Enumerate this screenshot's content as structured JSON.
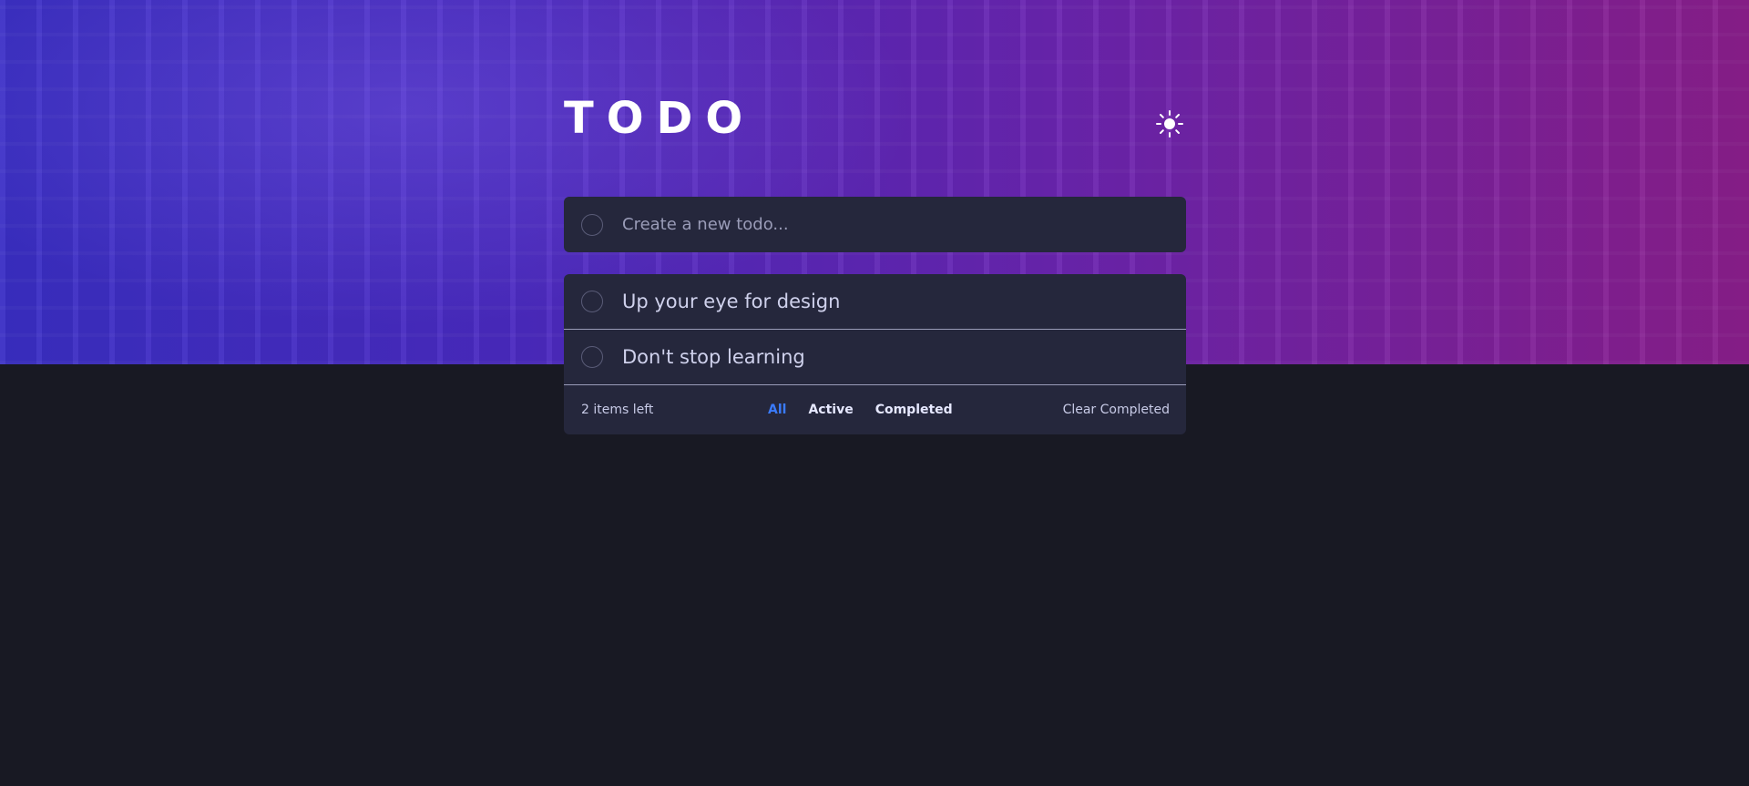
{
  "app": {
    "title": "TODO"
  },
  "theme_toggle": {
    "icon": "sun-icon"
  },
  "new_todo": {
    "placeholder": "Create a new todo..."
  },
  "todos": [
    {
      "text": "Up your eye for design",
      "completed": false
    },
    {
      "text": "Don't stop learning",
      "completed": false
    }
  ],
  "footer": {
    "items_left": "2 items left",
    "filters": [
      {
        "label": "All",
        "active": true
      },
      {
        "label": "Active",
        "active": false
      },
      {
        "label": "Completed",
        "active": false
      }
    ],
    "clear_label": "Clear Completed"
  },
  "colors": {
    "background": "#181923",
    "card": "#25273c",
    "accent": "#3a7bfd",
    "text": "#c8cbe7"
  }
}
